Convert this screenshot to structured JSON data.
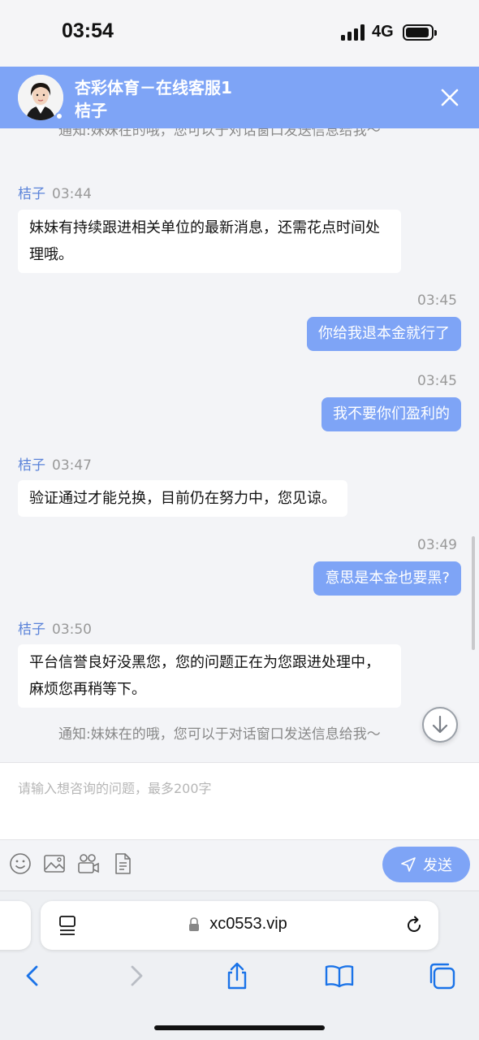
{
  "status_bar": {
    "time": "03:54",
    "network": "4G"
  },
  "header": {
    "title": "杏彩体育－在线客服1",
    "agent_name": "桔子"
  },
  "messages": {
    "notice_top": "通知:妹妹在的哦，您可以于对话窗口发送信息给我～",
    "m1": {
      "name": "桔子",
      "time": "03:44",
      "text": "妹妹有持续跟进相关单位的最新消息，还需花点时间处理哦。"
    },
    "m2": {
      "time": "03:45",
      "text": "你给我退本金就行了"
    },
    "m3": {
      "time": "03:45",
      "text": "我不要你们盈利的"
    },
    "m4": {
      "name": "桔子",
      "time": "03:47",
      "text": "验证通过才能兑换，目前仍在努力中，您见谅。"
    },
    "m5": {
      "time": "03:49",
      "text": "意思是本金也要黑?"
    },
    "m6": {
      "name": "桔子",
      "time": "03:50",
      "text": "平台信誉良好没黑您，您的问题正在为您跟进处理中，麻烦您再稍等下。"
    },
    "notice_bottom": "通知:妹妹在的哦，您可以于对话窗口发送信息给我～"
  },
  "input": {
    "placeholder": "请输入想咨询的问题，最多200字",
    "value": ""
  },
  "toolbar": {
    "send_label": "发送",
    "icons": [
      "emoji-icon",
      "image-icon",
      "video-icon",
      "file-icon"
    ]
  },
  "browser": {
    "url": "xc0553.vip"
  },
  "colors": {
    "accent": "#7ea4f6",
    "agent_name": "#5b83d9",
    "ios_blue": "#1a73e8"
  }
}
